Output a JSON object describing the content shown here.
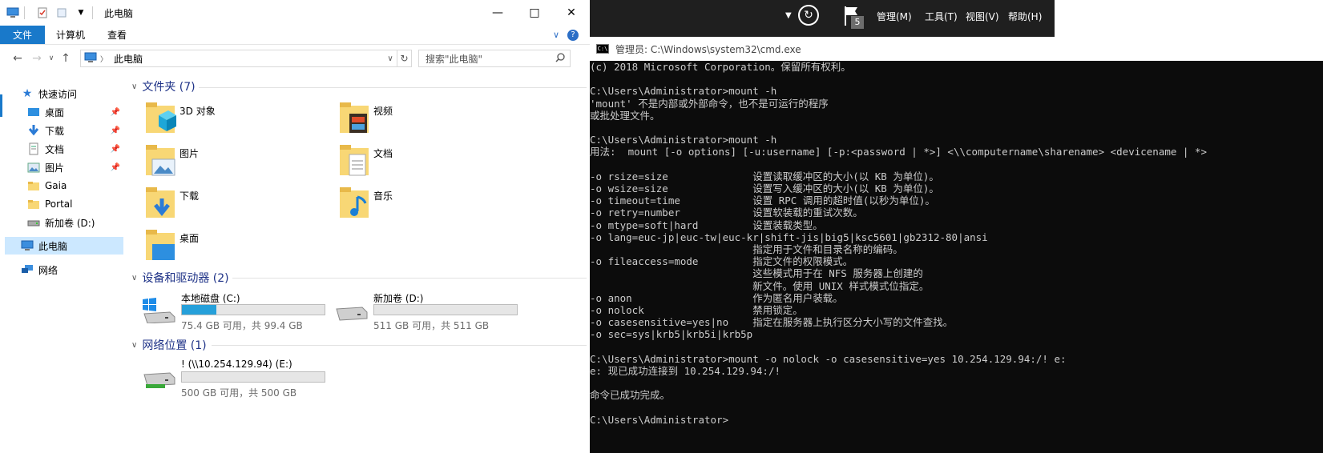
{
  "explorer": {
    "window_title": "此电脑",
    "ribbon_tabs": [
      "文件",
      "计算机",
      "查看"
    ],
    "address": "此电脑",
    "search_placeholder": "搜索\"此电脑\"",
    "nav": {
      "quick_access": "快速访问",
      "items": [
        {
          "label": "桌面",
          "icon": "desktop-icon",
          "pinned": true
        },
        {
          "label": "下载",
          "icon": "download-icon",
          "pinned": true
        },
        {
          "label": "文档",
          "icon": "document-icon",
          "pinned": true
        },
        {
          "label": "图片",
          "icon": "picture-icon",
          "pinned": true
        },
        {
          "label": "Gaia",
          "icon": "folder-icon",
          "pinned": false
        },
        {
          "label": "Portal",
          "icon": "folder-icon",
          "pinned": false
        },
        {
          "label": "新加卷 (D:)",
          "icon": "drive-icon",
          "pinned": false
        }
      ],
      "this_pc": "此电脑",
      "network": "网络"
    },
    "folders_header": "文件夹 (7)",
    "folders": [
      {
        "label": "3D 对象",
        "icon": "3d-objects-icon"
      },
      {
        "label": "视频",
        "icon": "video-icon"
      },
      {
        "label": "图片",
        "icon": "picture-icon"
      },
      {
        "label": "文档",
        "icon": "document-icon"
      },
      {
        "label": "下载",
        "icon": "download-icon"
      },
      {
        "label": "音乐",
        "icon": "music-icon"
      },
      {
        "label": "桌面",
        "icon": "desktop-icon"
      }
    ],
    "drives_header": "设备和驱动器 (2)",
    "drives": [
      {
        "name": "本地磁盘 (C:)",
        "info": "75.4 GB 可用，共 99.4 GB",
        "used_fraction": 0.24
      },
      {
        "name": "新加卷 (D:)",
        "info": "511 GB 可用，共 511 GB",
        "used_fraction": 0.0
      }
    ],
    "network_header": "网络位置 (1)",
    "network_drives": [
      {
        "name": "! (\\\\10.254.129.94) (E:)",
        "info": "500 GB 可用，共 500 GB",
        "used_fraction": 0.0
      }
    ]
  },
  "server_manager": {
    "menus": [
      "管理(M)",
      "工具(T)",
      "视图(V)",
      "帮助(H)"
    ],
    "flag_count": "5"
  },
  "cmd": {
    "title": "管理员: C:\\Windows\\system32\\cmd.exe",
    "lines": [
      "(c) 2018 Microsoft Corporation。保留所有权利。",
      "",
      "C:\\Users\\Administrator>mount -h",
      "'mount' 不是内部或外部命令，也不是可运行的程序",
      "或批处理文件。",
      "",
      "C:\\Users\\Administrator>mount -h",
      "用法:  mount [-o options] [-u:username] [-p:<password | *>] <\\\\computername\\sharename> <devicename | *>",
      "",
      "-o rsize=size              设置读取缓冲区的大小(以 KB 为单位)。",
      "-o wsize=size              设置写入缓冲区的大小(以 KB 为单位)。",
      "-o timeout=time            设置 RPC 调用的超时值(以秒为单位)。",
      "-o retry=number            设置软装载的重试次数。",
      "-o mtype=soft|hard         设置装载类型。",
      "-o lang=euc-jp|euc-tw|euc-kr|shift-jis|big5|ksc5601|gb2312-80|ansi",
      "                           指定用于文件和目录名称的编码。",
      "-o fileaccess=mode         指定文件的权限模式。",
      "                           这些模式用于在 NFS 服务器上创建的",
      "                           新文件。使用 UNIX 样式模式位指定。",
      "-o anon                    作为匿名用户装载。",
      "-o nolock                  禁用锁定。",
      "-o casesensitive=yes|no    指定在服务器上执行区分大小写的文件查找。",
      "-o sec=sys|krb5|krb5i|krb5p",
      "",
      "C:\\Users\\Administrator>mount -o nolock -o casesensitive=yes 10.254.129.94:/! e:",
      "e: 现已成功连接到 10.254.129.94:/!",
      "",
      "命令已成功完成。",
      "",
      "C:\\Users\\Administrator>"
    ]
  },
  "colors": {
    "accent": "#1979ca",
    "group_header": "#1e3287",
    "drive_bar_fill": "#26a0da",
    "cmd_bg": "#0c0c0c",
    "cmd_text": "#cccccc"
  }
}
